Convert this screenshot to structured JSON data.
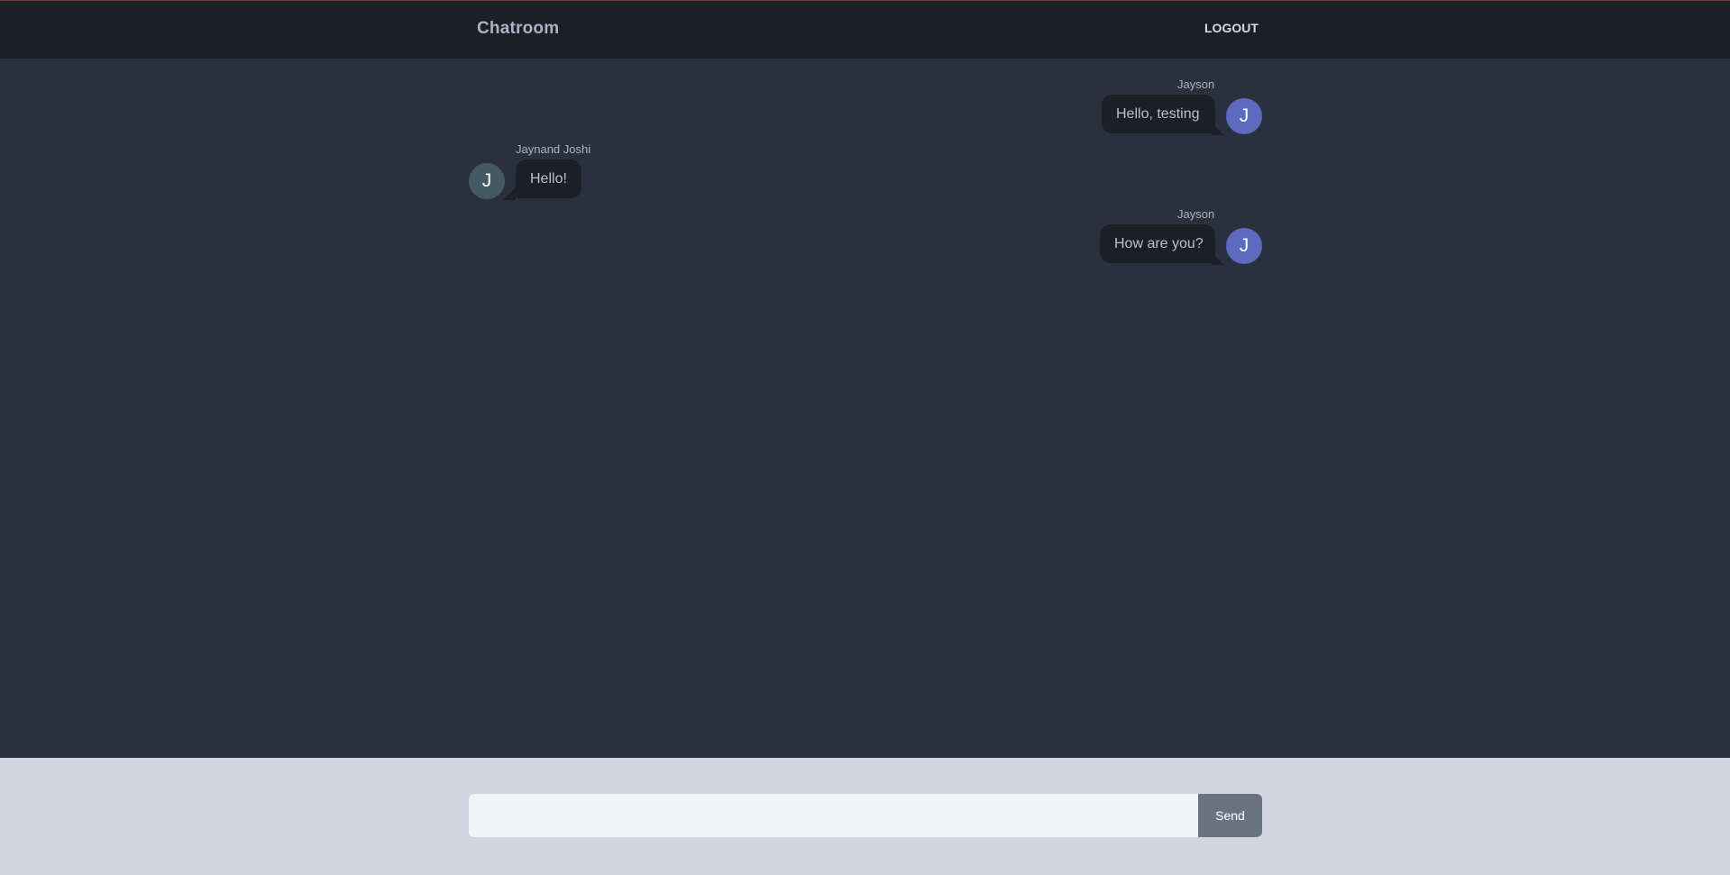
{
  "header": {
    "brand": "Chatroom",
    "logout_label": "LOGOUT"
  },
  "messages": [
    {
      "sender": "Jayson",
      "text": "Hello, testing",
      "initial": "J",
      "side": "right",
      "avatar_color": "#5c6bc0"
    },
    {
      "sender": "Jaynand Joshi",
      "text": "Hello!",
      "initial": "J",
      "side": "left",
      "avatar_color": "#455a64"
    },
    {
      "sender": "Jayson",
      "text": "How are you?",
      "initial": "J",
      "side": "right",
      "avatar_color": "#5c6bc0"
    }
  ],
  "composer": {
    "placeholder": "",
    "value": "",
    "send_label": "Send"
  },
  "colors": {
    "navbar": "#1c1f26",
    "chat_background": "#2a303c",
    "bubble": "#1c1f26",
    "footer": "#d3d6de",
    "send_button": "#6b7280"
  }
}
